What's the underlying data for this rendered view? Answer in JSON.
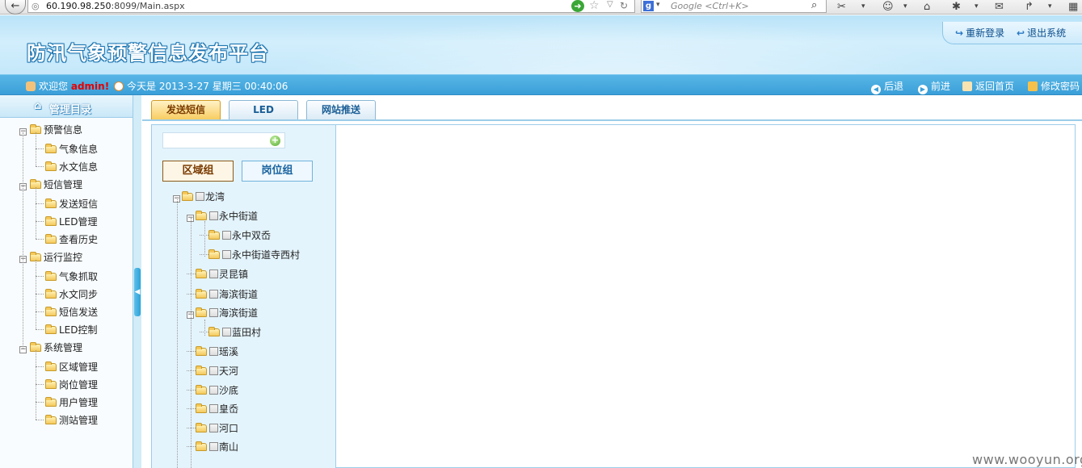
{
  "browser": {
    "back_icon": "back-arrow-icon",
    "url_prefix": "60.190.98.250",
    "url_suffix": ":8099/Main.aspx",
    "search_placeholder": "Google <Ctrl+K>",
    "search_engine_icon": "g"
  },
  "header": {
    "title": "防汛气象预警信息发布平台",
    "relogin_label": "重新登录",
    "logout_label": "退出系统"
  },
  "infobar": {
    "welcome_label": "欢迎您",
    "username": "admin!",
    "date_label": "今天是 2013-3-27 星期三 00:40:06",
    "back_label": "后退",
    "forward_label": "前进",
    "home_label": "返回首页",
    "change_password_label": "修改密码"
  },
  "sidebar": {
    "title": "管理目录",
    "groups": [
      {
        "label": "预警信息",
        "items": [
          "气象信息",
          "水文信息"
        ]
      },
      {
        "label": "短信管理",
        "items": [
          "发送短信",
          "LED管理",
          "查看历史"
        ]
      },
      {
        "label": "运行监控",
        "items": [
          "气象抓取",
          "水文同步",
          "短信发送",
          "LED控制"
        ]
      },
      {
        "label": "系统管理",
        "items": [
          "区域管理",
          "岗位管理",
          "用户管理",
          "测站管理"
        ]
      }
    ]
  },
  "tabs": [
    "发送短信",
    "LED",
    "网站推送"
  ],
  "content": {
    "group_buttons": [
      "区域组",
      "岗位组"
    ],
    "tree": [
      {
        "label": "龙湾",
        "level": 0,
        "expanded": true
      },
      {
        "label": "永中街道",
        "level": 1,
        "expanded": true
      },
      {
        "label": "永中双岙",
        "level": 2
      },
      {
        "label": "永中街道寺西村",
        "level": 2
      },
      {
        "label": "灵昆镇",
        "level": 1
      },
      {
        "label": "海滨街道",
        "level": 1
      },
      {
        "label": "海滨街道",
        "level": 1,
        "expanded": true
      },
      {
        "label": "蓝田村",
        "level": 2
      },
      {
        "label": "瑶溪",
        "level": 1
      },
      {
        "label": "天河",
        "level": 1
      },
      {
        "label": "沙底",
        "level": 1
      },
      {
        "label": "皇岙",
        "level": 1
      },
      {
        "label": "河口",
        "level": 1
      },
      {
        "label": "南山",
        "level": 1
      }
    ]
  },
  "watermark": "www.wooyun.org"
}
